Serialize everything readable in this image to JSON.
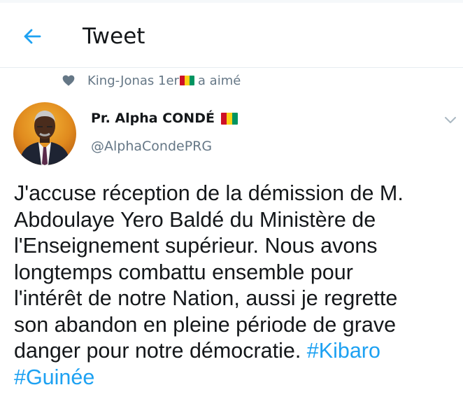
{
  "header": {
    "title": "Tweet",
    "back_icon": "arrow-left-icon"
  },
  "social_context": {
    "icon": "heart-icon",
    "name": "King-Jonas 1er",
    "action": "a aimé"
  },
  "tweet": {
    "author_name": "Pr. Alpha CONDÉ",
    "author_handle": "@AlphaCondePRG",
    "more_icon": "chevron-down-icon",
    "text_lines": [
      "J'accuse réception de la démission de M.",
      "Abdoulaye Yero Baldé du Ministère de",
      "l'Enseignement supérieur. Nous avons",
      "longtemps combattu ensemble pour",
      "l'intérêt de notre Nation, aussi je regrette",
      "son abandon en pleine période de grave",
      "danger pour notre démocratie."
    ],
    "hashtags": [
      "#Kibaro",
      "#Guinée"
    ]
  },
  "colors": {
    "accent": "#1da1f2",
    "text_primary": "#14171a",
    "text_secondary": "#657786",
    "divider": "#e6ecf0"
  }
}
